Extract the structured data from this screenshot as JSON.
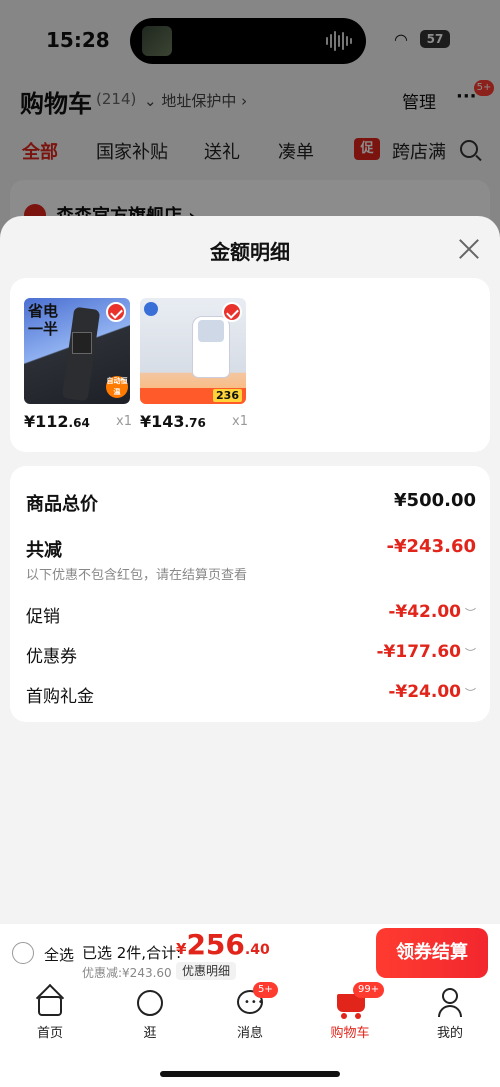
{
  "status_bar": {
    "time": "15:28",
    "battery": "57"
  },
  "header": {
    "title": "购物车",
    "count": "(214)",
    "address": "地址保护中",
    "manage": "管理",
    "more_badge": "5+"
  },
  "tabs": [
    {
      "label": "全部"
    },
    {
      "label": "国家补贴"
    },
    {
      "label": "送礼"
    },
    {
      "label": "凑单"
    },
    {
      "label": "跨店满"
    }
  ],
  "promo_tag": "促",
  "store": {
    "name": "森森官方旗舰店 ›"
  },
  "sheet": {
    "title": "金额明细",
    "products": [
      {
        "price_int": "¥112",
        "price_dec": ".64",
        "qty": "x1",
        "img_text": "省电\n一半",
        "badge": "自动恒温"
      },
      {
        "price_int": "¥143",
        "price_dec": ".76",
        "qty": "x1",
        "img_price": "236"
      }
    ],
    "summary": {
      "total_label": "商品总价",
      "total_value": "¥500.00",
      "reduce_label": "共减",
      "reduce_value": "-¥243.60",
      "note": "以下优惠不包含红包，请在结算页查看",
      "items": [
        {
          "label": "促销",
          "value": "-¥42.00"
        },
        {
          "label": "优惠券",
          "value": "-¥177.60"
        },
        {
          "label": "首购礼金",
          "value": "-¥24.00"
        }
      ]
    }
  },
  "checkout": {
    "select_all": "全选",
    "selected_info": "已选 2件,合计:",
    "total_yen": "¥",
    "total_int": "256",
    "total_dec": ".40",
    "discount": "优惠减:¥243.60",
    "detail": "优惠明细",
    "button": "领券结算"
  },
  "tabbar": [
    {
      "label": "首页"
    },
    {
      "label": "逛"
    },
    {
      "label": "消息",
      "badge": "5+"
    },
    {
      "label": "购物车",
      "badge": "99+"
    },
    {
      "label": "我的"
    }
  ],
  "colors": {
    "accent": "#e1251b",
    "sheet_bg": "#f3f3f3"
  }
}
